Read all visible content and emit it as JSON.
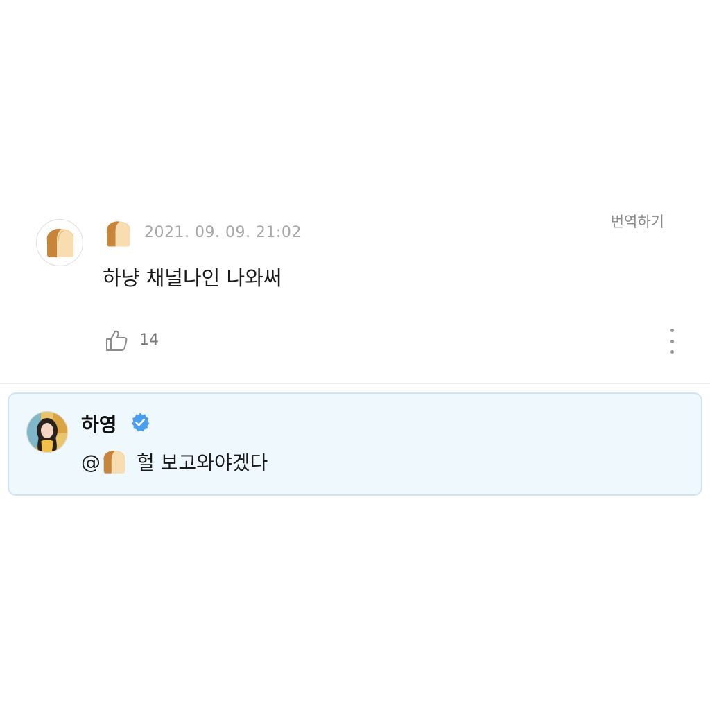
{
  "comment": {
    "author_icon": "bread-emoji-icon",
    "timestamp": "2021. 09. 09. 21:02",
    "translate_label": "번역하기",
    "text": "하냥 채널나인 나와써",
    "like_icon": "thumbs-up-icon",
    "like_count": "14",
    "more_icon": "vertical-ellipsis-icon"
  },
  "reply": {
    "author_name": "하영",
    "verified_icon": "verified-badge-icon",
    "mention_prefix": "@",
    "mention_icon": "bread-emoji-icon",
    "text": "헐 보고와야겠다"
  },
  "colors": {
    "timestamp": "#a6a6a6",
    "reply_background": "#eef8fd",
    "reply_border": "#cfe6f2",
    "verified": "#4a9ef0"
  }
}
